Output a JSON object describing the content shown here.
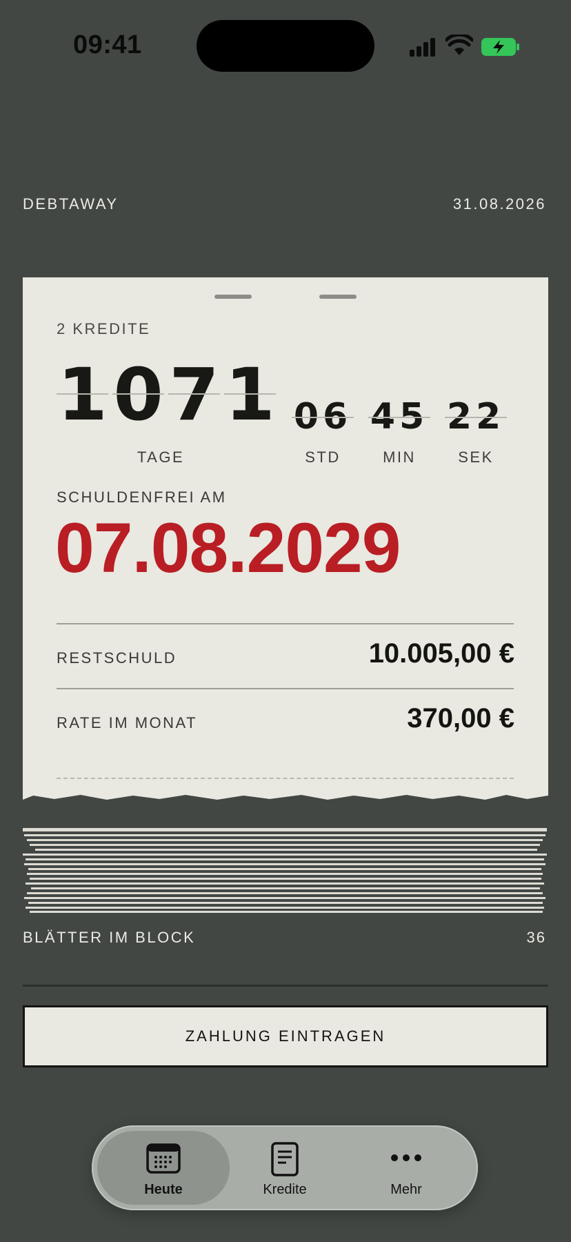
{
  "status_bar": {
    "time": "09:41"
  },
  "header": {
    "app_name": "DEBTAWAY",
    "date": "31.08.2026"
  },
  "card": {
    "kredite_label": "2 KREDITE",
    "countdown": {
      "days_digits": [
        "1",
        "0",
        "7",
        "1"
      ],
      "hours": "06",
      "minutes": "45",
      "seconds": "22",
      "units": {
        "days": "TAGE",
        "hours": "STD",
        "minutes": "MIN",
        "seconds": "SEK"
      }
    },
    "free_label": "SCHULDENFREI AM",
    "free_date": "07.08.2029",
    "rows": [
      {
        "label": "RESTSCHULD",
        "value": "10.005,00 €"
      },
      {
        "label": "RATE IM MONAT",
        "value": "370,00 €"
      }
    ]
  },
  "block": {
    "label": "BLÄTTER IM BLOCK",
    "count": "36"
  },
  "actions": {
    "pay_label": "ZAHLUNG EINTRAGEN"
  },
  "tabbar": {
    "items": [
      {
        "label": "Heute",
        "icon": "calendar-icon",
        "active": true
      },
      {
        "label": "Kredite",
        "icon": "document-icon",
        "active": false
      },
      {
        "label": "Mehr",
        "icon": "more-icon",
        "active": false
      }
    ]
  },
  "colors": {
    "background": "#424744",
    "paper": "#e9e8e1",
    "accent": "#b81e23",
    "tabbar": "#a9ada8"
  }
}
